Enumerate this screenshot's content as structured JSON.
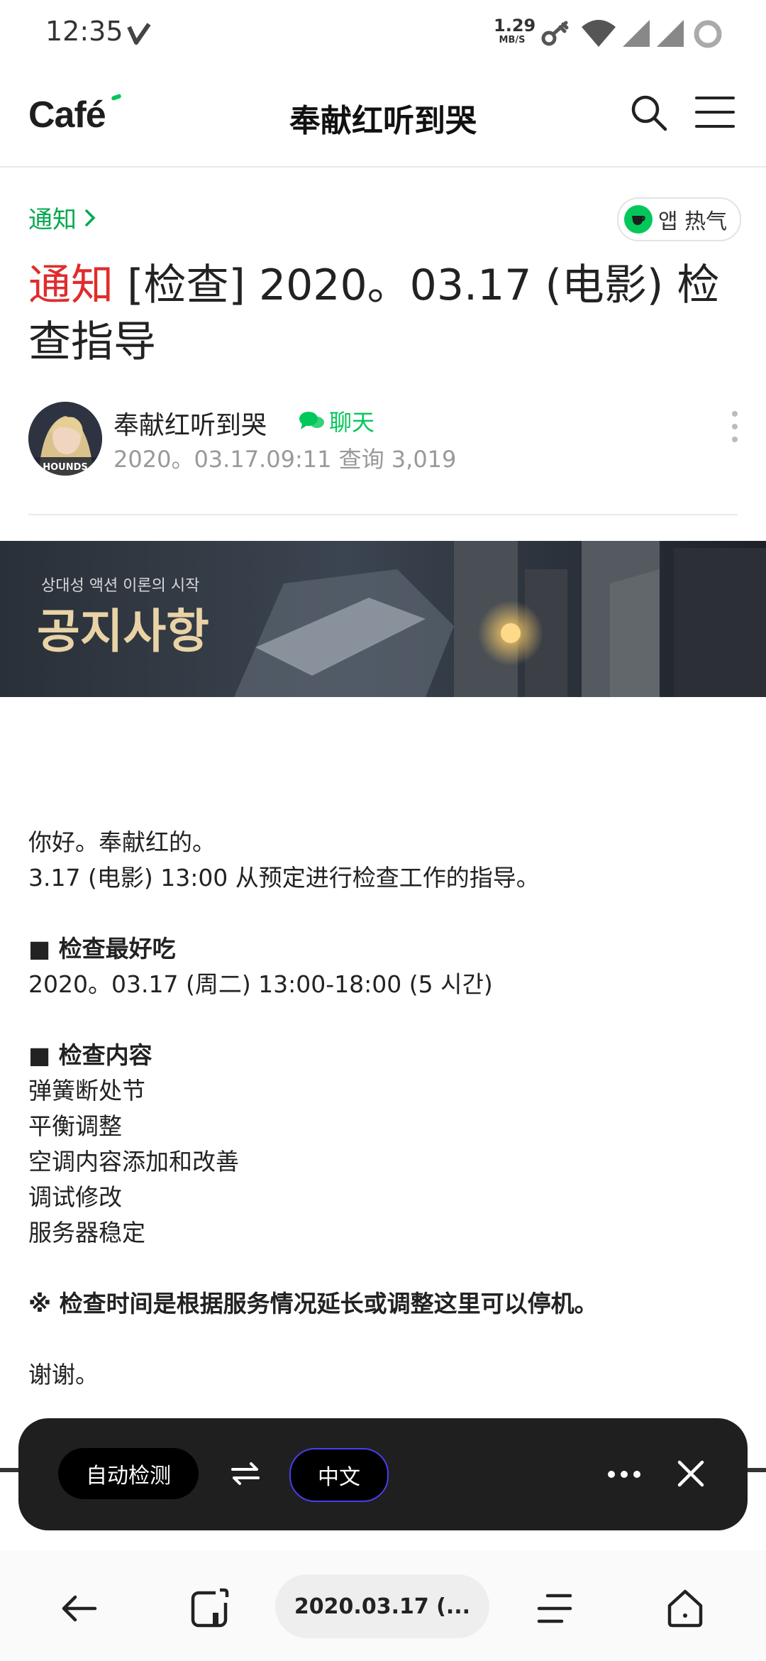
{
  "status_bar": {
    "time": "12:35",
    "net_speed_value": "1.29",
    "net_speed_unit": "MB/S",
    "icons": [
      "vpn-key-icon",
      "wifi-icon",
      "signal-icon",
      "signal-icon",
      "battery-icon"
    ]
  },
  "app_bar": {
    "logo": "Café",
    "title": "奉献红听到哭",
    "actions": [
      "search-icon",
      "menu-icon"
    ]
  },
  "post": {
    "board_link": "通知",
    "app_hot_label": "앱 热气",
    "title_tag": "通知",
    "title_text": " [检查] 2020。03.17 (电影) 检查指导",
    "author": {
      "name": "奉献红听到哭",
      "chat_label": "聊天",
      "avatar_label": "HOUNDS"
    },
    "meta": "2020。03.17.09:11 查询 3,019",
    "banner": {
      "subtitle": "상대성 액션 이론의 시작",
      "title": "공지사항"
    },
    "body": [
      {
        "text": "你好。奉献红的。",
        "bold": false
      },
      {
        "text": "3.17 (电影) 13:00 从预定进行检查工作的指导。",
        "bold": false
      },
      {
        "text": "",
        "bold": false
      },
      {
        "text": "■ 检查最好吃",
        "bold": true
      },
      {
        "text": "2020。03.17 (周二) 13:00-18:00 (5 시간)",
        "bold": false
      },
      {
        "text": "",
        "bold": false
      },
      {
        "text": "■ 检查内容",
        "bold": true
      },
      {
        "text": "弹簧断处节",
        "bold": false
      },
      {
        "text": "平衡调整",
        "bold": false
      },
      {
        "text": "空调内容添加和改善",
        "bold": false
      },
      {
        "text": "调试修改",
        "bold": false
      },
      {
        "text": "服务器稳定",
        "bold": false
      },
      {
        "text": "",
        "bold": false
      },
      {
        "text": "※ 检查时间是根据服务情况延长或调整这里可以停机。",
        "bold": true
      },
      {
        "text": "",
        "bold": false
      },
      {
        "text": "谢谢。",
        "bold": false
      }
    ]
  },
  "translate_bar": {
    "source_lang": "自动检测",
    "target_lang": "中文",
    "icons": [
      "swap-icon",
      "more-icon",
      "close-icon"
    ]
  },
  "bottom_nav": {
    "url_text": "2020.03.17 (...",
    "icons": [
      "back-arrow-icon",
      "tabs-icon",
      "menu-lines-icon",
      "home-icon"
    ]
  },
  "colors": {
    "brand_green": "#03c75a",
    "notice_red": "#e02c2c",
    "translate_bar_bg": "#1f1f1f"
  }
}
